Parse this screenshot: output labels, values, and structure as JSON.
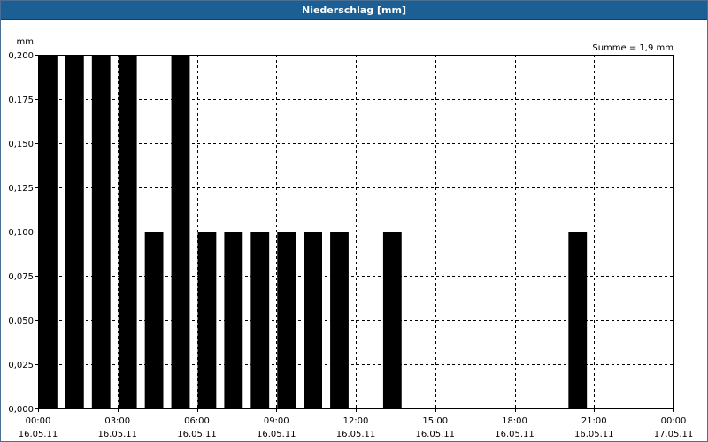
{
  "window": {
    "title": "Niederschlag [mm]"
  },
  "chart_data": {
    "type": "bar",
    "title": "Niederschlag [mm]",
    "ylabel": "mm",
    "annotation": "Summe = 1,9 mm",
    "ylim": [
      0,
      0.2
    ],
    "yticks": [
      "0,000",
      "0,025",
      "0,050",
      "0,075",
      "0,100",
      "0,125",
      "0,150",
      "0,175",
      "0,200"
    ],
    "xlim_hours": [
      0,
      24
    ],
    "xticks": [
      {
        "time": "00:00",
        "date": "16.05.11"
      },
      {
        "time": "03:00",
        "date": "16.05.11"
      },
      {
        "time": "06:00",
        "date": "16.05.11"
      },
      {
        "time": "09:00",
        "date": "16.05.11"
      },
      {
        "time": "12:00",
        "date": "16.05.11"
      },
      {
        "time": "15:00",
        "date": "16.05.11"
      },
      {
        "time": "18:00",
        "date": "16.05.11"
      },
      {
        "time": "21:00",
        "date": "16.05.11"
      },
      {
        "time": "00:00",
        "date": "17.05.11"
      }
    ],
    "series": [
      {
        "bar_color": "#000000",
        "x": [
          "00:00",
          "01:00",
          "02:00",
          "03:00",
          "04:00",
          "05:00",
          "06:00",
          "07:00",
          "08:00",
          "09:00",
          "10:00",
          "11:00",
          "13:00",
          "20:00"
        ],
        "values": [
          0.2,
          0.2,
          0.2,
          0.2,
          0.1,
          0.2,
          0.1,
          0.1,
          0.1,
          0.1,
          0.1,
          0.1,
          0.1,
          0.1
        ]
      }
    ],
    "grid": true,
    "grid_style": "dashed"
  }
}
